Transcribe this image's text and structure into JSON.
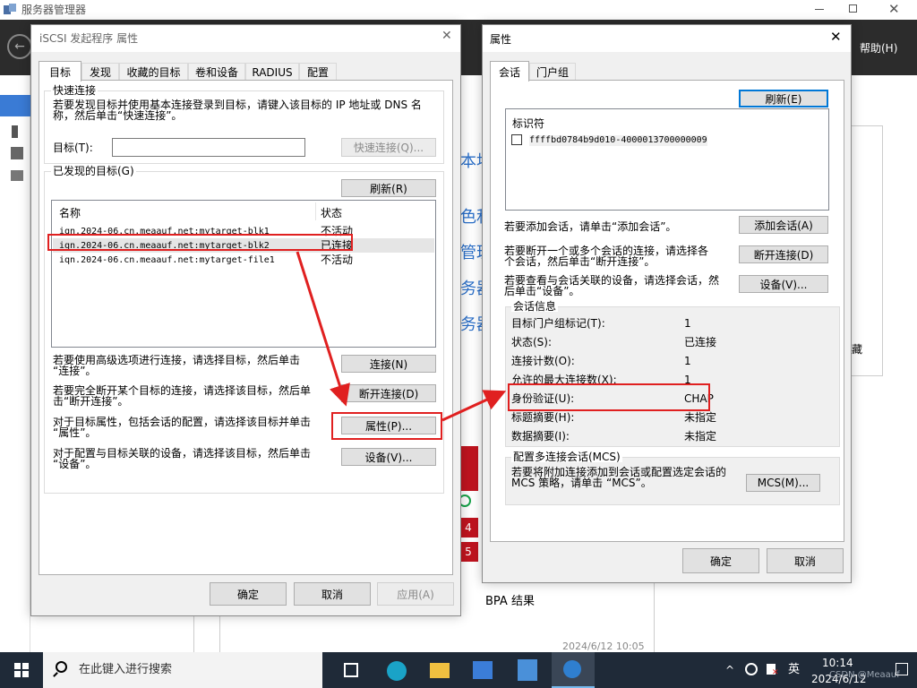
{
  "app": {
    "title": "服务器管理器",
    "help_label": "帮助(H)"
  },
  "background": {
    "side_texts": [
      "本地",
      "色和",
      "管理",
      "务器",
      "务器"
    ],
    "right_edge_text": "藏",
    "bpa": "BPA 结果",
    "timestamp": "2024/6/12 10:05",
    "badges": [
      "4",
      "5"
    ]
  },
  "iscsi": {
    "title": "iSCSI 发起程序 属性",
    "tabs": [
      "目标",
      "发现",
      "收藏的目标",
      "卷和设备",
      "RADIUS",
      "配置"
    ],
    "quick_connect": {
      "group_label": "快速连接",
      "desc_line1": "若要发现目标并使用基本连接登录到目标，请键入该目标的 IP 地址或 DNS 名",
      "desc_line2": "称，然后单击“快速连接”。",
      "target_label": "目标(T):",
      "target_value": "",
      "button": "快速连接(Q)..."
    },
    "discovered": {
      "group_label": "已发现的目标(G)",
      "refresh": "刷新(R)",
      "col_name": "名称",
      "col_status": "状态",
      "rows": [
        {
          "name": "iqn.2024-06.cn.meaauf.net:mytarget-blk1",
          "status": "不活动"
        },
        {
          "name": "iqn.2024-06.cn.meaauf.net:mytarget-blk2",
          "status": "已连接"
        },
        {
          "name": "iqn.2024-06.cn.meaauf.net:mytarget-file1",
          "status": "不活动"
        }
      ]
    },
    "actions": [
      {
        "line1": "若要使用高级选项进行连接，请选择目标，然后单击",
        "line2": "“连接”。",
        "button": "连接(N)"
      },
      {
        "line1": "若要完全断开某个目标的连接，请选择该目标，然后单",
        "line2": "击“断开连接”。",
        "button": "断开连接(D)"
      },
      {
        "line1": "对于目标属性，包括会话的配置，请选择该目标并单击",
        "line2": "“属性”。",
        "button": "属性(P)..."
      },
      {
        "line1": "对于配置与目标关联的设备，请选择该目标，然后单击",
        "line2": "“设备”。",
        "button": "设备(V)..."
      }
    ],
    "ok": "确定",
    "cancel": "取消",
    "apply": "应用(A)"
  },
  "props": {
    "title": "属性",
    "tabs": [
      "会话",
      "门户组"
    ],
    "refresh": "刷新(E)",
    "list_header": "标识符",
    "session_id": "ffffbd0784b9d010-4000013700000009",
    "add_session_text": "若要添加会话，请单击“添加会话”。",
    "add_session_btn": "添加会话(A)",
    "disconnect_line1": "若要断开一个或多个会话的连接，请选择各",
    "disconnect_line2": "个会话，然后单击“断开连接”。",
    "disconnect_btn": "断开连接(D)",
    "devices_line1": "若要查看与会话关联的设备，请选择会话，然",
    "devices_line2": "后单击“设备”。",
    "devices_btn": "设备(V)...",
    "session_info": {
      "group_label": "会话信息",
      "rows": [
        {
          "label": "目标门户组标记(T):",
          "value": "1"
        },
        {
          "label": "状态(S):",
          "value": "已连接"
        },
        {
          "label": "连接计数(O):",
          "value": "1"
        },
        {
          "label": "允许的最大连接数(X):",
          "value": "1"
        },
        {
          "label": "身份验证(U):",
          "value": "CHAP"
        },
        {
          "label": "标题摘要(H):",
          "value": "未指定"
        },
        {
          "label": "数据摘要(I):",
          "value": "未指定"
        }
      ]
    },
    "mcs": {
      "group_label": "配置多连接会话(MCS)",
      "line1": "若要将附加连接添加到会话或配置选定会话的",
      "line2": "MCS 策略，请单击 “MCS”。",
      "button": "MCS(M)..."
    },
    "ok": "确定",
    "cancel": "取消"
  },
  "taskbar": {
    "search_placeholder": "在此键入进行搜索",
    "ime": "英",
    "time": "10:14",
    "date": "2024/6/12",
    "watermark": "CSDN @Meaauf"
  },
  "colors": {
    "highlight_red": "#e02020",
    "taskbar": "#1f2a38",
    "dark_header": "#2c2c2c"
  }
}
